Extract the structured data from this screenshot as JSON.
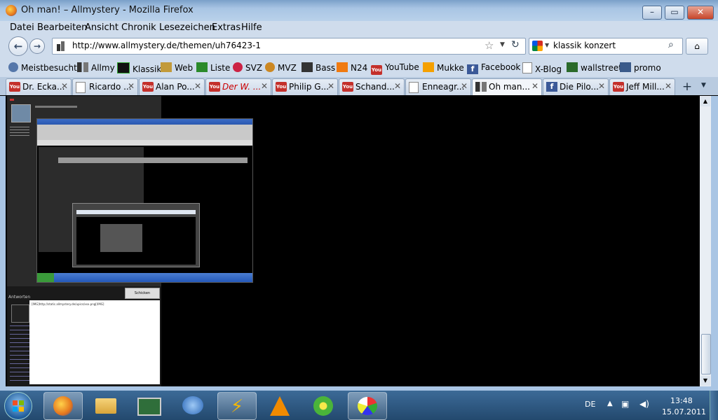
{
  "window": {
    "title": "Oh man! – Allmystery - Mozilla Firefox"
  },
  "menu": [
    "Datei",
    "Bearbeiten",
    "Ansicht",
    "Chronik",
    "Lesezeichen",
    "Extras",
    "Hilfe"
  ],
  "nav": {
    "url": "http://www.allmystery.de/themen/uh76423-1",
    "search_value": "klassik konzert"
  },
  "bookmarks": [
    {
      "label": "Meistbesucht",
      "icon": "gear-icon"
    },
    {
      "label": "Allmy",
      "icon": "allmy-icon"
    },
    {
      "label": "Klassik",
      "icon": "klassik-icon"
    },
    {
      "label": "Web",
      "icon": "web-icon"
    },
    {
      "label": "Liste",
      "icon": "liste-icon"
    },
    {
      "label": "SVZ",
      "icon": "svz-icon"
    },
    {
      "label": "MVZ",
      "icon": "mvz-icon"
    },
    {
      "label": "Bass",
      "icon": "bass-icon"
    },
    {
      "label": "N24",
      "icon": "n24-icon"
    },
    {
      "label": "YouTube",
      "icon": "youtube-icon"
    },
    {
      "label": "Mukke",
      "icon": "mukke-icon"
    },
    {
      "label": "Facebook",
      "icon": "facebook-icon"
    },
    {
      "label": "X-Blog",
      "icon": "page-icon"
    },
    {
      "label": "wallstreet",
      "icon": "wallstreet-icon"
    },
    {
      "label": "promo",
      "icon": "promo-icon"
    }
  ],
  "tabs": [
    {
      "label": "Dr. Ecka...",
      "icon": "youtube-icon"
    },
    {
      "label": "Ricardo ...",
      "icon": "page-icon"
    },
    {
      "label": "Alan Po...",
      "icon": "youtube-icon"
    },
    {
      "label": "Der W. ...",
      "icon": "youtube-icon"
    },
    {
      "label": "Philip G...",
      "icon": "youtube-icon"
    },
    {
      "label": "Schand...",
      "icon": "youtube-icon"
    },
    {
      "label": "Enneagr...",
      "icon": "page-icon"
    },
    {
      "label": "Oh man...",
      "icon": "allmy-icon",
      "active": true
    },
    {
      "label": "Die Pilo...",
      "icon": "facebook-icon"
    },
    {
      "label": "Jeff Mill...",
      "icon": "youtube-icon"
    }
  ],
  "page": {
    "reply_label": "Antworten",
    "reply_text": "[IMG]http://static.allmystery.de/upics/xxx.png[/IMG]",
    "send_button": "Schicken"
  },
  "tray": {
    "lang": "DE",
    "time": "13:48",
    "date": "15.07.2011"
  },
  "colors": {
    "youtube": "#c4302b",
    "facebook": "#3b5998",
    "accent": "#cfdcec"
  }
}
